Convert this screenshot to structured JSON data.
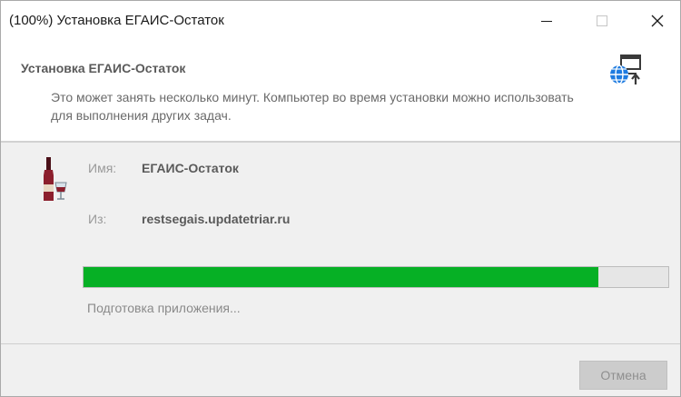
{
  "window": {
    "title": "(100%) Установка ЕГАИС-Остаток"
  },
  "header": {
    "title": "Установка ЕГАИС-Остаток",
    "description": "Это может занять несколько минут. Компьютер во время установки можно использовать для выполнения других задач."
  },
  "app": {
    "name_label": "Имя:",
    "name_value": "ЕГАИС-Остаток",
    "from_label": "Из:",
    "from_value": "restsegais.updatetriar.ru"
  },
  "progress": {
    "fraction": 0.88,
    "color": "#06b025",
    "status": "Подготовка приложения..."
  },
  "footer": {
    "cancel_label": "Отмена"
  },
  "icons": {
    "minimize": "minimize-icon",
    "maximize": "maximize-icon",
    "close": "close-icon",
    "header": "web-install-icon",
    "app": "wine-bottle-icon"
  }
}
